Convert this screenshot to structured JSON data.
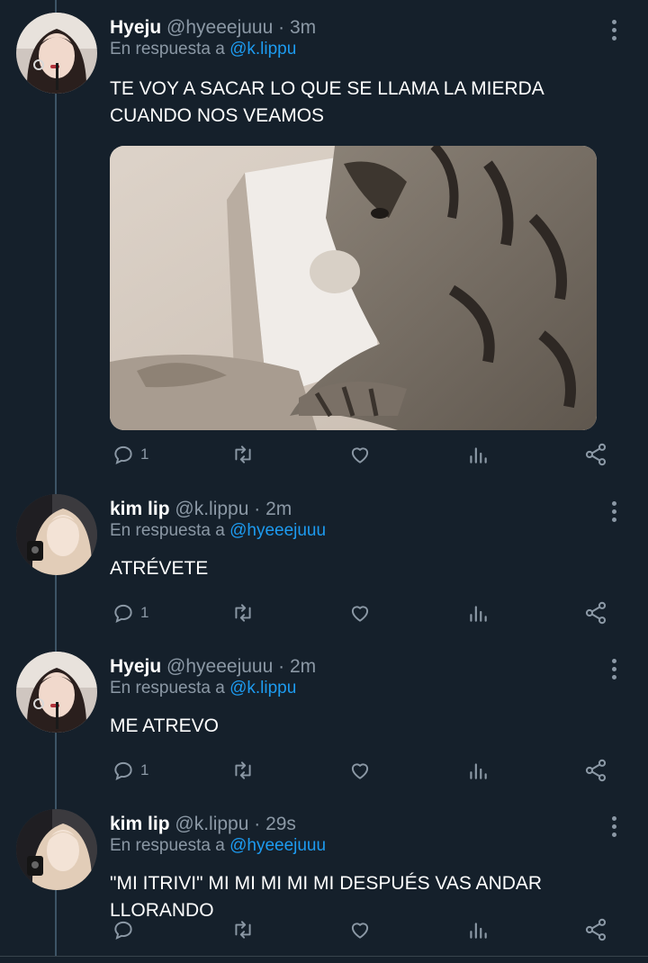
{
  "tweets": [
    {
      "name": "Hyeju",
      "handle": "@hyeeejuuu",
      "time": "· 3m",
      "reply_prefix": "En respuesta a",
      "reply_to": "@k.lippu",
      "text": "TE VOY A SACAR LO QUE SE LLAMA LA MIERDA CUANDO NOS VEAMOS",
      "reply_count": "1",
      "avatar_icon": "avatar-photo-hyeju",
      "has_media": true
    },
    {
      "name": "kim lip",
      "handle": "@k.lippu",
      "time": "· 2m",
      "reply_prefix": "En respuesta a",
      "reply_to": "@hyeeejuuu",
      "text": "ATRÉVETE",
      "reply_count": "1",
      "avatar_icon": "avatar-photo-kimlip"
    },
    {
      "name": "Hyeju",
      "handle": "@hyeeejuuu",
      "time": "· 2m",
      "reply_prefix": "En respuesta a",
      "reply_to": "@k.lippu",
      "text": "ME ATREVO",
      "reply_count": "1",
      "avatar_icon": "avatar-photo-hyeju"
    },
    {
      "name": "kim lip",
      "handle": "@k.lippu",
      "time": "· 29s",
      "reply_prefix": "En respuesta a",
      "reply_to": "@hyeeejuuu",
      "text": "\"MI ITRIVI\" MI MI MI MI MI DESPUÉS VAS ANDAR LLORANDO",
      "reply_count": "",
      "avatar_icon": "avatar-photo-kimlip"
    }
  ],
  "icons": {
    "reply": "reply-icon",
    "retweet": "retweet-icon",
    "like": "heart-icon",
    "views": "views-icon",
    "share": "share-icon",
    "more": "more-options-icon"
  },
  "colors": {
    "background": "#15202b",
    "accent": "#1d9bf0",
    "secondary_text": "#8b98a5",
    "thread_line": "#3d5466"
  }
}
